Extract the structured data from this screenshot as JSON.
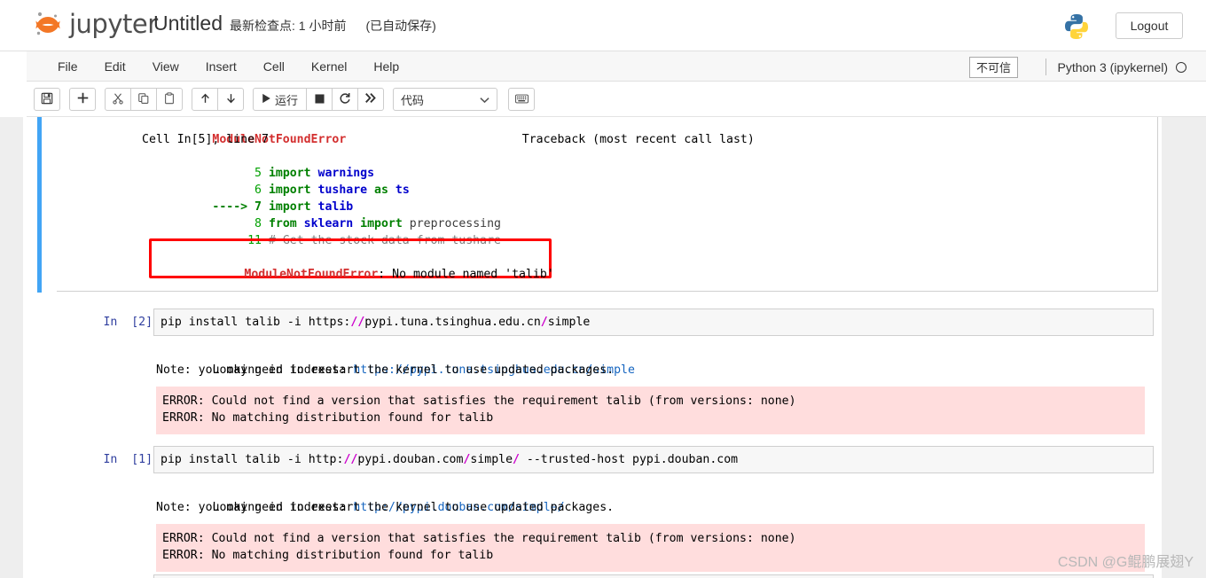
{
  "header": {
    "brand": "jupyter",
    "notebook_name": "Untitled",
    "checkpoint": "最新检查点: 1 小时前",
    "autosave": "(已自动保存)",
    "logout_label": "Logout",
    "python_logo_icon": "python-logo-icon"
  },
  "menubar": {
    "items": [
      {
        "label": "File"
      },
      {
        "label": "Edit"
      },
      {
        "label": "View"
      },
      {
        "label": "Insert"
      },
      {
        "label": "Cell"
      },
      {
        "label": "Kernel"
      },
      {
        "label": "Help"
      }
    ],
    "trust_label": "不可信",
    "kernel_label": "Python 3 (ipykernel)",
    "kernel_status_icon": "kernel-idle-circle-icon"
  },
  "toolbar": {
    "save_icon": "floppy-disk-icon",
    "insert_icon": "plus-icon",
    "cut_icon": "scissors-icon",
    "copy_icon": "copy-icon",
    "paste_icon": "paste-icon",
    "move_up_icon": "arrow-up-icon",
    "move_down_icon": "arrow-down-icon",
    "run_icon": "play-triangle-icon",
    "run_label": "运行",
    "stop_icon": "stop-square-icon",
    "restart_icon": "restart-circular-arrow-icon",
    "fast_forward_icon": "double-chevron-right-icon",
    "cell_type_value": "代码",
    "cell_type_caret_icon": "chevron-down-icon",
    "command_palette_icon": "keyboard-icon"
  },
  "traceback": {
    "header_error": "ModuleNotFoundError",
    "header_right": "Traceback (most recent call last)",
    "cell_line": "Cell In[5], line 7",
    "lines": [
      {
        "num": "5",
        "marker": "",
        "kw": "import",
        "rest": " warnings"
      },
      {
        "num": "6",
        "marker": "",
        "kw": "import",
        "rest": " tushare as ts"
      },
      {
        "num": "7",
        "marker": "---->",
        "kw": "import",
        "rest": " talib"
      },
      {
        "num": "8",
        "marker": "",
        "kw": "from",
        "rest": " sklearn import preprocessing"
      },
      {
        "num": "11",
        "marker": "",
        "kw": "",
        "rest": "# Get the stock data from tushare"
      }
    ],
    "final_error_name": "ModuleNotFoundError",
    "final_error_msg": ": No module named 'talib'",
    "annotation_color": "#ff0000"
  },
  "cells": [
    {
      "prompt": "In  [2]:",
      "source": "pip install talib -i https://pypi.tuna.tsinghua.edu.cn/simple",
      "output_lines": [
        "Looking in indexes: https://pypi.tuna.tsinghua.edu.cn/simple",
        "Note: you may need to restart the kernel to use updated packages."
      ],
      "looking_prefix": "Looking in indexes: ",
      "looking_url": "https://pypi.tuna.tsinghua.edu.cn/simple",
      "note_line": "Note: you may need to restart the kernel to use updated packages.",
      "error_lines": [
        "ERROR: Could not find a version that satisfies the requirement talib (from versions: none)",
        "ERROR: No matching distribution found for talib"
      ]
    },
    {
      "prompt": "In  [1]:",
      "source": "pip install talib -i http://pypi.douban.com/simple/ --trusted-host pypi.douban.com",
      "looking_prefix": "Looking in indexes: ",
      "looking_url": "http://pypi.douban.com/simple/",
      "note_line": "Note: you may need to restart the kernel to use updated packages.",
      "error_lines": [
        "ERROR: Could not find a version that satisfies the requirement talib (from versions: none)",
        "ERROR: No matching distribution found for talib"
      ]
    }
  ],
  "watermark": {
    "text": "CSDN @G鲲鹏展翅Y"
  },
  "colors": {
    "accent_orange": "#f37726",
    "selected_cell_bar": "#42a5f5",
    "error_bg": "#ffdddd",
    "prompt_blue": "#303f9f",
    "link_blue": "#1565c0"
  }
}
